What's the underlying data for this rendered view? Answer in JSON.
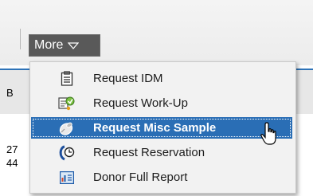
{
  "toolbar": {
    "more_label": "More"
  },
  "background": {
    "header_fragment": "B",
    "row1_fragment": "27",
    "row2_fragment": "44"
  },
  "menu": {
    "items": [
      {
        "label": "Request IDM",
        "icon": "clipboard-icon",
        "selected": false
      },
      {
        "label": "Request Work-Up",
        "icon": "workup-icon",
        "selected": false
      },
      {
        "label": "Request Misc Sample",
        "icon": "sample-tube-icon",
        "selected": true
      },
      {
        "label": "Request Reservation",
        "icon": "reservation-clock-icon",
        "selected": false
      },
      {
        "label": "Donor Full Report",
        "icon": "report-chart-icon",
        "selected": false
      }
    ]
  },
  "colors": {
    "accent": "#2a6eb5",
    "button_bg": "#595959",
    "menu_bg": "#f2f2f2"
  }
}
